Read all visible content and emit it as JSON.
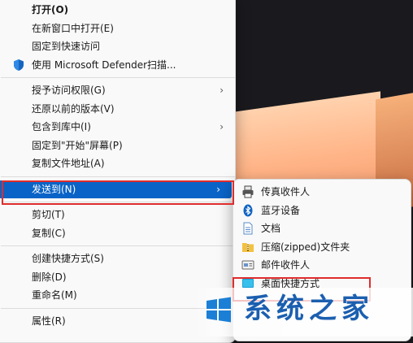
{
  "main_menu": {
    "items": [
      {
        "label": "打开(O)",
        "bold": true,
        "icon": null,
        "has_submenu": false
      },
      {
        "label": "在新窗口中打开(E)",
        "icon": null,
        "has_submenu": false
      },
      {
        "label": "固定到快速访问",
        "icon": null,
        "has_submenu": false
      },
      {
        "label": "使用 Microsoft Defender扫描...",
        "icon": "defender-shield-icon",
        "has_submenu": false
      },
      {
        "label": "授予访问权限(G)",
        "icon": null,
        "has_submenu": true
      },
      {
        "label": "还原以前的版本(V)",
        "icon": null,
        "has_submenu": false
      },
      {
        "label": "包含到库中(I)",
        "icon": null,
        "has_submenu": true
      },
      {
        "label": "固定到\"开始\"屏幕(P)",
        "icon": null,
        "has_submenu": false
      },
      {
        "label": "复制文件地址(A)",
        "icon": null,
        "has_submenu": false
      },
      {
        "label": "发送到(N)",
        "icon": null,
        "has_submenu": true,
        "highlighted": true
      },
      {
        "label": "剪切(T)",
        "icon": null,
        "has_submenu": false
      },
      {
        "label": "复制(C)",
        "icon": null,
        "has_submenu": false
      },
      {
        "label": "创建快捷方式(S)",
        "icon": null,
        "has_submenu": false
      },
      {
        "label": "删除(D)",
        "icon": null,
        "has_submenu": false
      },
      {
        "label": "重命名(M)",
        "icon": null,
        "has_submenu": false
      },
      {
        "label": "属性(R)",
        "icon": null,
        "has_submenu": false
      }
    ],
    "submenu_arrow": "›"
  },
  "send_to_menu": {
    "items": [
      {
        "label": "传真收件人",
        "icon": "fax-printer-icon"
      },
      {
        "label": "蓝牙设备",
        "icon": "bluetooth-icon"
      },
      {
        "label": "文档",
        "icon": "documents-folder-icon"
      },
      {
        "label": "压缩(zipped)文件夹",
        "icon": "zip-folder-icon"
      },
      {
        "label": "邮件收件人",
        "icon": "mail-recipient-icon"
      },
      {
        "label": "桌面快捷方式",
        "icon": "desktop-icon"
      }
    ]
  },
  "watermark": {
    "text": "系统之家",
    "logo": "windows-logo-icon"
  },
  "colors": {
    "highlight": "#0a64c8",
    "annotation_red": "#e02c2c",
    "menu_bg": "#f9f9f9",
    "watermark_blue": "#1b5fb0"
  }
}
